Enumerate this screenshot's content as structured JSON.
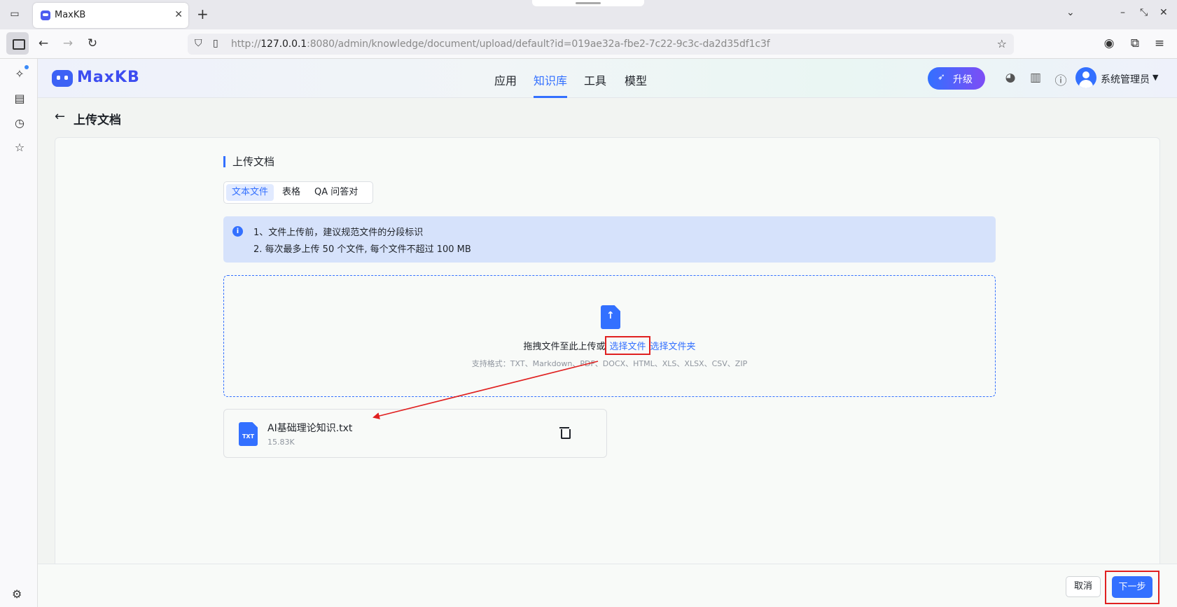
{
  "browser": {
    "tab_title": "MaxKB",
    "url_prefix": "http://",
    "url_host": "127.0.0.1",
    "url_rest": ":8080/admin/knowledge/document/upload/default?id=019ae32a-fbe2-7c22-9c3c-da2d35df1c3f"
  },
  "app": {
    "logo_text": "MaxKB",
    "nav": [
      {
        "label": "应用",
        "active": false
      },
      {
        "label": "知识库",
        "active": true
      },
      {
        "label": "工具",
        "active": false
      },
      {
        "label": "模型",
        "active": false
      }
    ],
    "upgrade_label": "升级",
    "username": "系统管理员"
  },
  "page": {
    "title": "上传文档",
    "section_title": "上传文档",
    "tabs": [
      {
        "label": "文本文件",
        "active": true
      },
      {
        "label": "表格",
        "active": false
      },
      {
        "label": "QA 问答对",
        "active": false
      }
    ],
    "tips": [
      "1、文件上传前，建议规范文件的分段标识",
      "2. 每次最多上传 50 个文件, 每个文件不超过 100 MB"
    ],
    "dropzone": {
      "prompt": "拖拽文件至此上传或",
      "select_file": "选择文件",
      "select_folder": "选择文件夹",
      "formats": "支持格式：TXT、Markdown、PDF、DOCX、HTML、XLS、XLSX、CSV、ZIP"
    },
    "file": {
      "type": "TXT",
      "name": "AI基础理论知识.txt",
      "size": "15.83K"
    },
    "cancel_label": "取消",
    "next_label": "下一步"
  },
  "colors": {
    "accent": "#3370ff",
    "highlight": "#e02020"
  }
}
